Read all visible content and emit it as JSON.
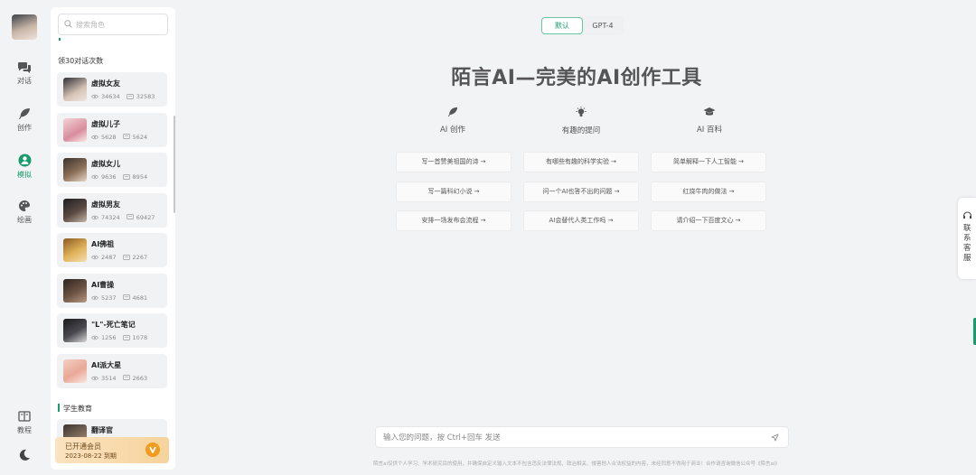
{
  "nav": {
    "items": [
      {
        "label": "对话",
        "icon": "chat-icon"
      },
      {
        "label": "创作",
        "icon": "feather-icon"
      },
      {
        "label": "模拟",
        "icon": "role-icon",
        "active": true
      },
      {
        "label": "绘画",
        "icon": "palette-icon"
      }
    ],
    "bottom": {
      "label": "教程",
      "icon": "book-icon"
    },
    "theme_icon": "moon-icon"
  },
  "sidebar": {
    "search_placeholder": "搜索角色",
    "section1": "领30对话次数",
    "roles": [
      {
        "name": "虚拟女友",
        "views": "34634",
        "chats": "32583"
      },
      {
        "name": "虚拟儿子",
        "views": "5628",
        "chats": "5624"
      },
      {
        "name": "虚拟女儿",
        "views": "9636",
        "chats": "8954"
      },
      {
        "name": "虚拟男友",
        "views": "74324",
        "chats": "69427"
      },
      {
        "name": "AI佛祖",
        "views": "2487",
        "chats": "2267"
      },
      {
        "name": "AI曹操",
        "views": "5237",
        "chats": "4681"
      },
      {
        "name": "\"L\"-死亡笔记",
        "views": "1256",
        "chats": "1078"
      },
      {
        "name": "AI派大星",
        "views": "3514",
        "chats": "2663"
      }
    ],
    "section2": "学生教育",
    "partial_role": "翻译官",
    "member": {
      "title": "已开通会员",
      "expiry": "2023-08-22 到期"
    }
  },
  "main": {
    "model_tabs": [
      {
        "label": "默认",
        "active": true
      },
      {
        "label": "GPT-4",
        "active": false
      }
    ],
    "headline": "陌言AI—完美的AI创作工具",
    "categories": [
      {
        "label": "AI 创作",
        "icon": "feather-icon"
      },
      {
        "label": "有趣的提问",
        "icon": "bulb-icon"
      },
      {
        "label": "AI 百科",
        "icon": "graduation-cap-icon"
      }
    ],
    "prompts": [
      [
        "写一首赞美祖国的诗 →",
        "写一篇科幻小说 →",
        "安排一场发布会流程 →"
      ],
      [
        "有哪些有趣的科学实验 →",
        "问一个AI也答不出的问题 →",
        "AI会替代人类工作吗 →"
      ],
      [
        "简单解释一下人工智能 →",
        "红烧牛肉的做法 →",
        "请介绍一下百度文心 →"
      ]
    ],
    "input_placeholder": "输入您的问题，按 Ctrl+回车 发送",
    "footer": "陌言ai仅供个人学习、学术研究目的使用，并确保自定义输入文本不包含违反法律法规、政治相关、侵害他人合法权益的内容，未经同意不得用于商业！合作请咨询微信公众号《陌言ai》"
  },
  "service": {
    "label": "联系客服"
  },
  "colors": {
    "accent": "#1a9b6b",
    "member_gold": "#f29c1f",
    "bg": "#f2f3f5"
  }
}
